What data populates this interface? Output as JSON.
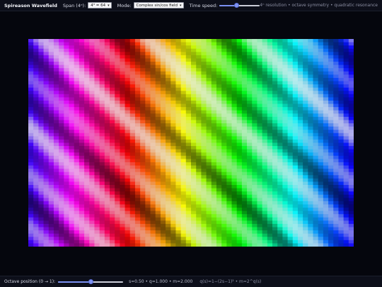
{
  "app": {
    "title": "Spireason Wavefield"
  },
  "toolbar": {
    "span_label": "Span (4ⁿ):",
    "span_value": "4³ = 64",
    "mode_label": "Mode:",
    "mode_value": "Complex sin/cos field",
    "speed_label": "Time speed:",
    "speed_level": 0.42,
    "hint": "4ⁿ resolution • octave symmetry • quadratic resonance"
  },
  "bottom": {
    "octave_label": "Octave position (0 → 1):",
    "octave_level": 0.5,
    "readout": "s=0.50 • q=1.000 • m=2.000",
    "formula": "q(s)=1−(2s−1)² • m=2^q(s)"
  },
  "colors": {
    "accent": "#7a8ff0",
    "background": "#05060d",
    "bar": "#0d0f1a"
  },
  "icons": {
    "select_arrow": "chevron-down-icon"
  }
}
